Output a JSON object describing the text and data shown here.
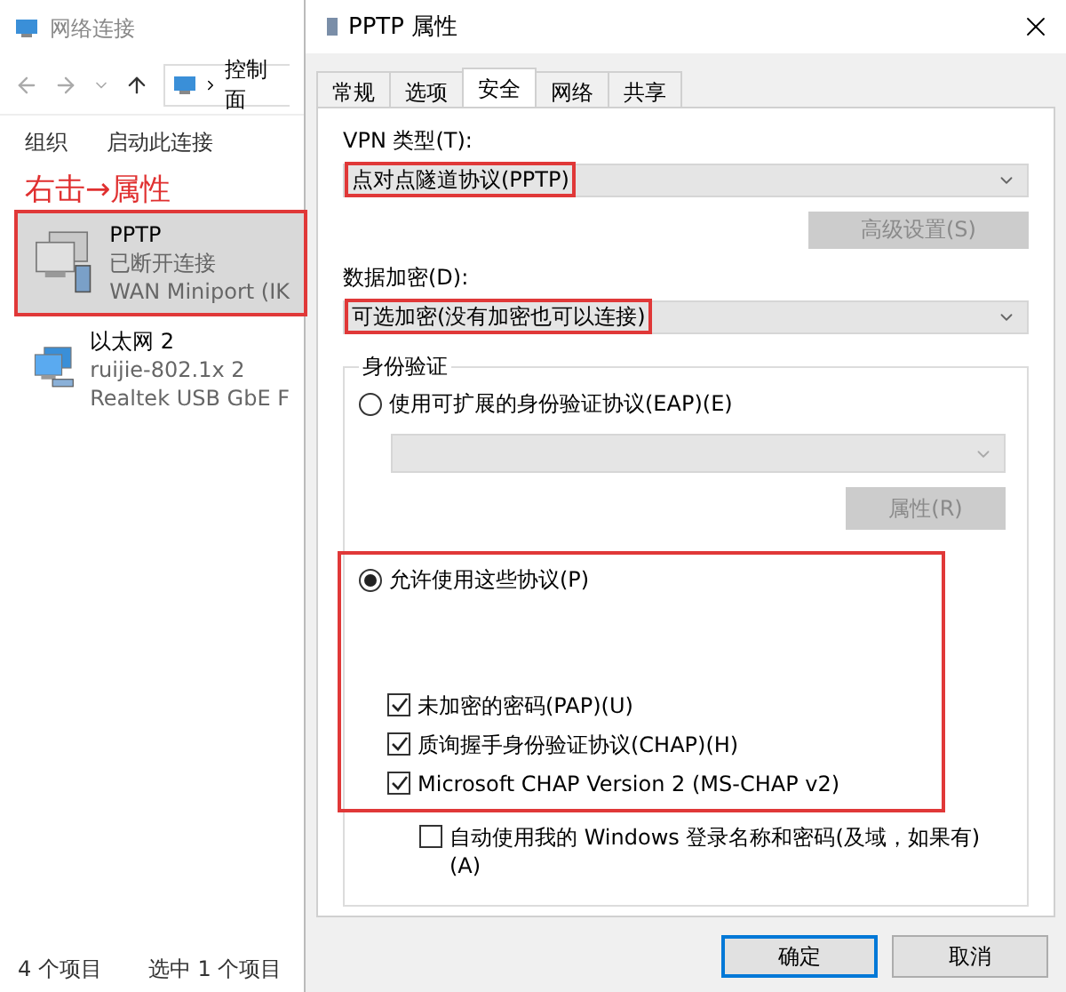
{
  "explorer": {
    "title": "网络连接",
    "address": "控制面",
    "toolbar": [
      "组织",
      "启动此连接"
    ],
    "annotation": "右击→属性",
    "connections": [
      {
        "name": "PPTP",
        "lines": [
          "已断开连接",
          "WAN Miniport (IK"
        ],
        "selected": true,
        "highlighted": true,
        "kind": "vpn"
      },
      {
        "name": "以太网 2",
        "lines": [
          "ruijie-802.1x 2",
          "Realtek USB GbE F"
        ],
        "selected": false,
        "highlighted": false,
        "kind": "ethernet"
      }
    ],
    "status": [
      "4 个项目",
      "选中 1 个项目"
    ]
  },
  "dialog": {
    "title": "PPTP 属性",
    "tabs": [
      {
        "label": "常规",
        "selected": false
      },
      {
        "label": "选项",
        "selected": false
      },
      {
        "label": "安全",
        "selected": true
      },
      {
        "label": "网络",
        "selected": false
      },
      {
        "label": "共享",
        "selected": false
      }
    ],
    "vpn_type": {
      "label": "VPN 类型(T):",
      "value": "点对点隧道协议(PPTP)",
      "highlighted": true
    },
    "advanced_button": {
      "label": "高级设置(S)",
      "disabled": true
    },
    "encryption": {
      "label": "数据加密(D):",
      "value": "可选加密(没有加密也可以连接)",
      "highlighted": true
    },
    "auth": {
      "legend": "身份验证",
      "eap": {
        "label": "使用可扩展的身份验证协议(EAP)(E)",
        "selected": false
      },
      "eap_properties": {
        "label": "属性(R)",
        "disabled": true
      },
      "allow": {
        "label": "允许使用这些协议(P)",
        "selected": true,
        "highlighted": true
      },
      "protocols": [
        {
          "label": "未加密的密码(PAP)(U)",
          "checked": true
        },
        {
          "label": "质询握手身份验证协议(CHAP)(H)",
          "checked": true
        },
        {
          "label": "Microsoft CHAP Version 2 (MS-CHAP v2)",
          "checked": true
        }
      ],
      "auto_login": {
        "label": "自动使用我的 Windows 登录名称和密码(及域，如果有)(A)",
        "checked": false
      }
    },
    "buttons": [
      {
        "label": "确定",
        "kind": "default"
      },
      {
        "label": "取消",
        "kind": "normal"
      }
    ]
  }
}
